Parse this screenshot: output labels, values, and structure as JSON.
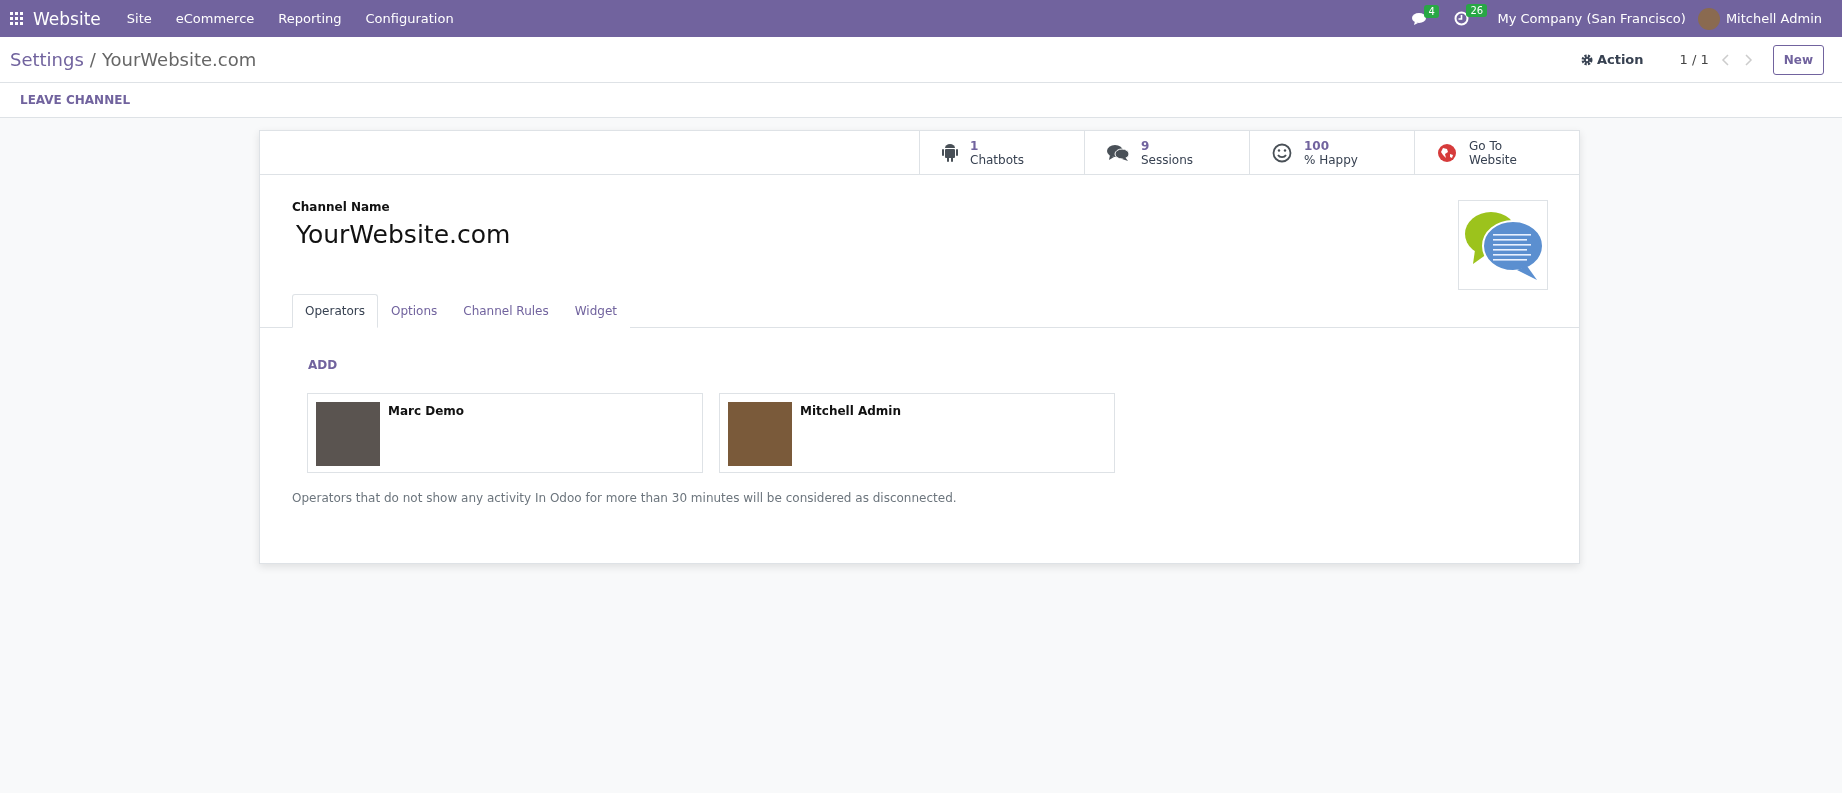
{
  "navbar": {
    "app": "Website",
    "menu": [
      "Site",
      "eCommerce",
      "Reporting",
      "Configuration"
    ],
    "messages_count": "4",
    "activities_count": "26",
    "company": "My Company (San Francisco)",
    "user": "Mitchell Admin"
  },
  "control_panel": {
    "breadcrumb_parent": "Settings",
    "breadcrumb_separator": "/",
    "breadcrumb_current": "YourWebsite.com",
    "action": "Action",
    "pager": "1 / 1",
    "new_button": "New"
  },
  "status_bar": {
    "button": "LEAVE CHANNEL"
  },
  "stat_buttons": [
    {
      "kind": "chatbots",
      "value": "1",
      "label": "Chatbots"
    },
    {
      "kind": "sessions",
      "value": "9",
      "label": "Sessions"
    },
    {
      "kind": "happy",
      "value": "100",
      "label": "% Happy"
    },
    {
      "kind": "website",
      "value": "Go To",
      "label": "Website"
    }
  ],
  "form": {
    "field_label": "Channel Name",
    "channel_name": "YourWebsite.com"
  },
  "tabs": [
    {
      "label": "Operators",
      "selected": true
    },
    {
      "label": "Options",
      "selected": false
    },
    {
      "label": "Channel Rules",
      "selected": false
    },
    {
      "label": "Widget",
      "selected": false
    }
  ],
  "operators": {
    "add": "ADD",
    "cards": [
      {
        "name": "Marc Demo"
      },
      {
        "name": "Mitchell Admin"
      }
    ],
    "note": "Operators that do not show any activity In Odoo for more than 30 minutes will be considered as disconnected."
  }
}
